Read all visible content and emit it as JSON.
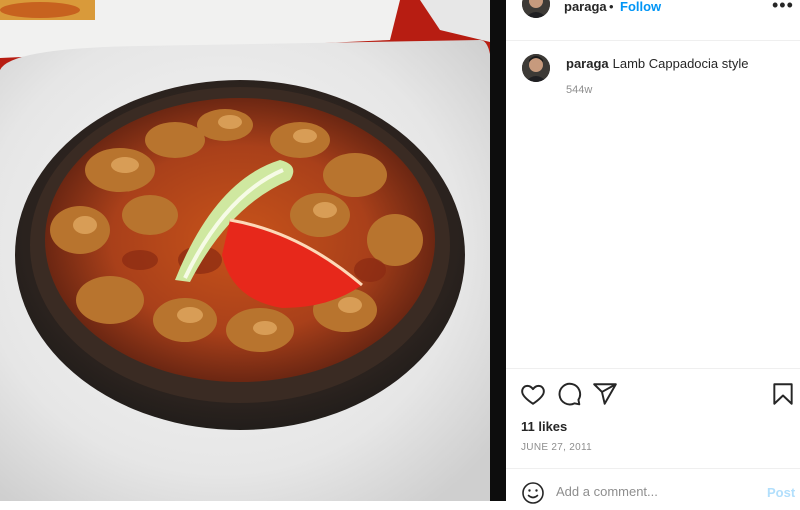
{
  "post": {
    "image_alt": "Lamb Cappadocia style in a clay pot",
    "author": {
      "username": "paraga",
      "separator": "•",
      "follow_label": "Follow"
    },
    "more_icon": "more-horizontal-icon",
    "caption": {
      "username": "paraga",
      "text": "Lamb Cappadocia style",
      "time_ago": "544w"
    },
    "actions": {
      "icons": [
        "heart-icon",
        "comment-icon",
        "share-icon",
        "bookmark-icon"
      ]
    },
    "likes": "11 likes",
    "date": "JUNE 27, 2011",
    "comment": {
      "placeholder": "Add a comment...",
      "post_label": "Post",
      "emoji_icon": "emoji-icon"
    }
  },
  "colors": {
    "accent": "#0095f6",
    "post_disabled": "#b2dffc",
    "text": "#262626",
    "muted": "#8e8e8e"
  }
}
